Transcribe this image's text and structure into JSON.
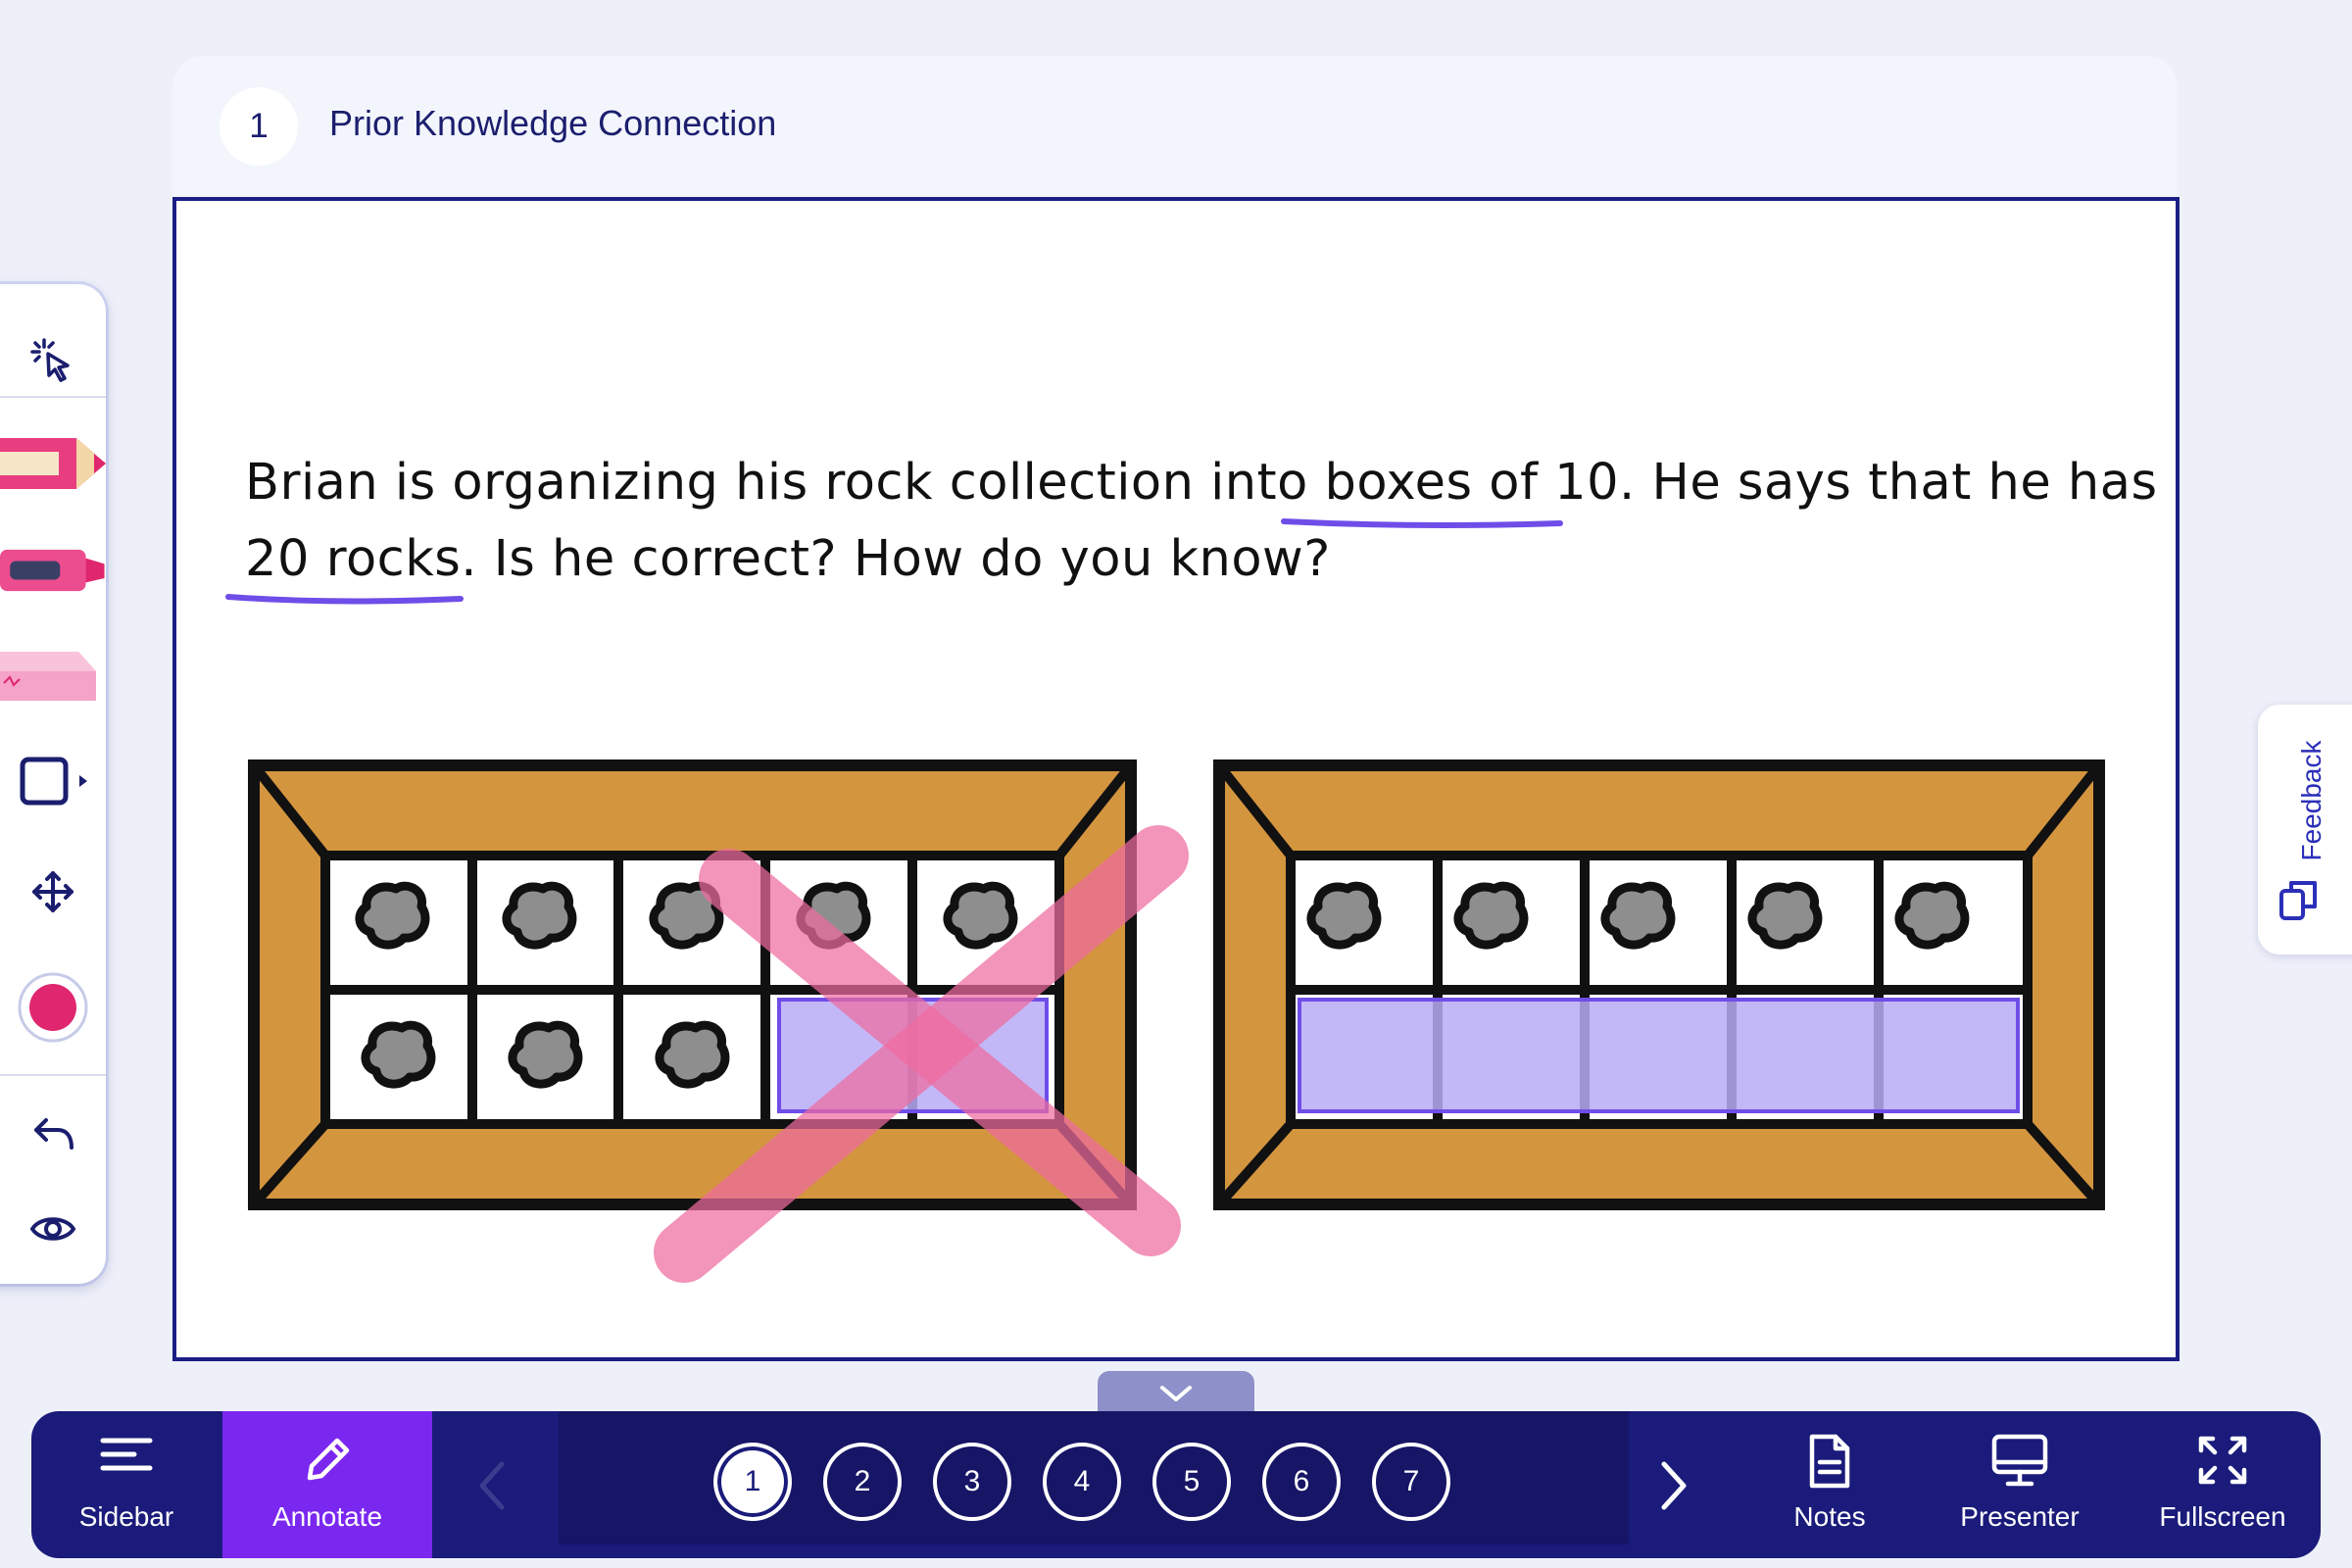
{
  "slide": {
    "number": "1",
    "title": "Prior Knowledge Connection",
    "prompt_line1": "Brian is organizing his rock collection into boxes of 10. He says that he has",
    "prompt_line2": "20 rocks. Is he correct? How do you know?",
    "left_box": {
      "rows": 2,
      "cols": 5,
      "rocks": 8,
      "highlighted_empty_cells": 2,
      "crossed_out": true
    },
    "right_box": {
      "rows": 2,
      "cols": 5,
      "rocks": 5,
      "highlighted_empty_cells": 5,
      "crossed_out": false
    }
  },
  "toolbar": {
    "tools": [
      "laser-pointer-icon",
      "pencil-icon",
      "highlighter-icon",
      "eraser-icon",
      "shape-icon",
      "move-icon",
      "color-swatch",
      "undo-icon",
      "visibility-icon"
    ],
    "selected_color": "#e0266f"
  },
  "feedback": {
    "label": "Feedback"
  },
  "bottom_bar": {
    "sidebar_label": "Sidebar",
    "annotate_label": "Annotate",
    "pages": [
      "1",
      "2",
      "3",
      "4",
      "5",
      "6",
      "7"
    ],
    "current_page": "1",
    "notes_label": "Notes",
    "presenter_label": "Presenter",
    "fullscreen_label": "Fullscreen"
  },
  "colors": {
    "navy": "#1a1b7a",
    "accent_purple": "#7a28f0",
    "highlight": "#c4b8f7",
    "underline": "#6f4de8",
    "cross": "#ee6ba0",
    "box_wood": "#d4953f"
  }
}
